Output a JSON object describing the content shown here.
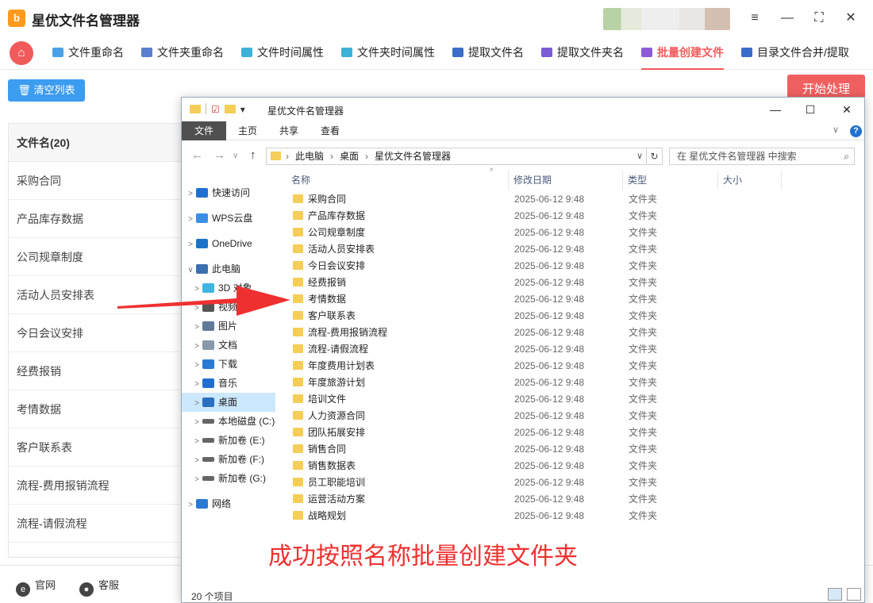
{
  "app": {
    "logo": "b",
    "name": "星优文件名管理器",
    "controls": [
      "≡",
      "—",
      "⛶",
      "✕"
    ]
  },
  "toolbar": {
    "home_icon": "⌂",
    "tabs": [
      {
        "label": "文件重命名",
        "color": "#4aa0e6"
      },
      {
        "label": "文件夹重命名",
        "color": "#5b7fd0"
      },
      {
        "label": "文件时间属性",
        "color": "#3db1d8"
      },
      {
        "label": "文件夹时间属性",
        "color": "#3db1d8"
      },
      {
        "label": "提取文件名",
        "color": "#3b6cc8"
      },
      {
        "label": "提取文件夹名",
        "color": "#7a5cd6"
      },
      {
        "label": "批量创建文件",
        "color": "#8c5cd6"
      },
      {
        "label": "目录文件合并/提取",
        "color": "#3b6cc8"
      }
    ]
  },
  "actions": {
    "clear_label": "清空列表",
    "start_label": "开始处理"
  },
  "file_list": {
    "header": "文件名(20)",
    "rows": [
      "采购合同",
      "产品库存数据",
      "公司规章制度",
      "活动人员安排表",
      "今日会议安排",
      "经费报销",
      "考情数据",
      "客户联系表",
      "流程-费用报销流程",
      "流程-请假流程"
    ]
  },
  "footer": {
    "website_icon": "e",
    "website": "官网",
    "service_icon": "●",
    "service": "客服"
  },
  "explorer": {
    "title": "星优文件名管理器",
    "controls": [
      "—",
      "☐",
      "✕"
    ],
    "ribbon": [
      "文件",
      "主页",
      "共享",
      "查看"
    ],
    "help": "?",
    "nav_arrows": [
      "←",
      "→",
      "∨",
      "↑"
    ],
    "breadcrumb": [
      "此电脑",
      "桌面",
      "星优文件名管理器"
    ],
    "search_placeholder": "在 星优文件名管理器 中搜索",
    "nav_pane": [
      {
        "label": "快速访问",
        "caret": ">",
        "icon_color": "#1f6fd1"
      },
      {
        "label": "WPS云盘",
        "caret": ">",
        "icon_color": "#3a8ee6"
      },
      {
        "label": "OneDrive",
        "caret": ">",
        "icon_color": "#1a73c8"
      },
      {
        "label": "此电脑",
        "caret": "∨",
        "icon_color": "#3a6fb0"
      },
      {
        "label": "3D 对象",
        "caret": ">",
        "icon_color": "#42b4e0"
      },
      {
        "label": "视频",
        "caret": ">",
        "icon_color": "#555555"
      },
      {
        "label": "图片",
        "caret": ">",
        "icon_color": "#607a99"
      },
      {
        "label": "文档",
        "caret": ">",
        "icon_color": "#8899aa"
      },
      {
        "label": "下载",
        "caret": ">",
        "icon_color": "#2a7ad4"
      },
      {
        "label": "音乐",
        "caret": ">",
        "icon_color": "#1f6fd1"
      },
      {
        "label": "桌面",
        "caret": ">",
        "icon_color": "#2a6fc0"
      },
      {
        "label": "本地磁盘 (C:)",
        "caret": ">",
        "icon_color": "#666666"
      },
      {
        "label": "新加卷 (E:)",
        "caret": ">",
        "icon_color": "#666666"
      },
      {
        "label": "新加卷 (F:)",
        "caret": ">",
        "icon_color": "#666666"
      },
      {
        "label": "新加卷 (G:)",
        "caret": ">",
        "icon_color": "#666666"
      },
      {
        "label": "网络",
        "caret": ">",
        "icon_color": "#2a7ad4"
      }
    ],
    "columns": [
      "名称",
      "修改日期",
      "类型",
      "大小"
    ],
    "sort_icon": "^",
    "files": [
      {
        "name": "采购合同",
        "date": "2025-06-12 9:48",
        "type": "文件夹"
      },
      {
        "name": "产品库存数据",
        "date": "2025-06-12 9:48",
        "type": "文件夹"
      },
      {
        "name": "公司规章制度",
        "date": "2025-06-12 9:48",
        "type": "文件夹"
      },
      {
        "name": "活动人员安排表",
        "date": "2025-06-12 9:48",
        "type": "文件夹"
      },
      {
        "name": "今日会议安排",
        "date": "2025-06-12 9:48",
        "type": "文件夹"
      },
      {
        "name": "经费报销",
        "date": "2025-06-12 9:48",
        "type": "文件夹"
      },
      {
        "name": "考情数据",
        "date": "2025-06-12 9:48",
        "type": "文件夹"
      },
      {
        "name": "客户联系表",
        "date": "2025-06-12 9:48",
        "type": "文件夹"
      },
      {
        "name": "流程-费用报销流程",
        "date": "2025-06-12 9:48",
        "type": "文件夹"
      },
      {
        "name": "流程-请假流程",
        "date": "2025-06-12 9:48",
        "type": "文件夹"
      },
      {
        "name": "年度费用计划表",
        "date": "2025-06-12 9:48",
        "type": "文件夹"
      },
      {
        "name": "年度旅游计划",
        "date": "2025-06-12 9:48",
        "type": "文件夹"
      },
      {
        "name": "培训文件",
        "date": "2025-06-12 9:48",
        "type": "文件夹"
      },
      {
        "name": "人力资源合同",
        "date": "2025-06-12 9:48",
        "type": "文件夹"
      },
      {
        "name": "团队拓展安排",
        "date": "2025-06-12 9:48",
        "type": "文件夹"
      },
      {
        "name": "销售合同",
        "date": "2025-06-12 9:48",
        "type": "文件夹"
      },
      {
        "name": "销售数据表",
        "date": "2025-06-12 9:48",
        "type": "文件夹"
      },
      {
        "name": "员工职能培训",
        "date": "2025-06-12 9:48",
        "type": "文件夹"
      },
      {
        "name": "运营活动方案",
        "date": "2025-06-12 9:48",
        "type": "文件夹"
      },
      {
        "name": "战略规划",
        "date": "2025-06-12 9:48",
        "type": "文件夹"
      }
    ],
    "status": "20 个项目"
  },
  "caption": "成功按照名称批量创建文件夹",
  "colors": {
    "accent": "#f05a5a",
    "primary": "#3c9cf0",
    "arrow": "#ef3030"
  }
}
